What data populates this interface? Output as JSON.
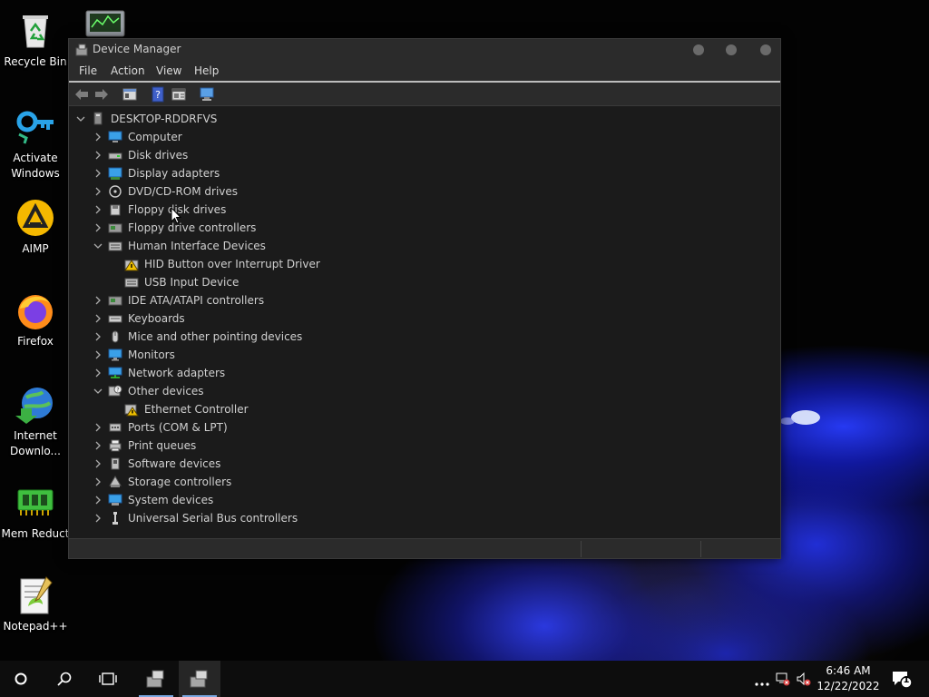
{
  "desktop": {
    "icons": [
      {
        "label": "Recycle Bin"
      },
      {
        "label": "Activate Windows"
      },
      {
        "label": "AIMP"
      },
      {
        "label": "Firefox"
      },
      {
        "label": "Internet Downlo..."
      },
      {
        "label": "Mem Reduct"
      },
      {
        "label": "Notepad++"
      }
    ]
  },
  "window": {
    "title": "Device Manager",
    "menu": [
      "File",
      "Action",
      "View",
      "Help"
    ],
    "tree": {
      "root": "DESKTOP-RDDRFVS",
      "items": [
        {
          "label": "Computer",
          "icon": "computer-icon",
          "expanded": false
        },
        {
          "label": "Disk drives",
          "icon": "disk-drive-icon",
          "expanded": false
        },
        {
          "label": "Display adapters",
          "icon": "display-adapter-icon",
          "expanded": false
        },
        {
          "label": "DVD/CD-ROM drives",
          "icon": "dvd-drive-icon",
          "expanded": false
        },
        {
          "label": "Floppy disk drives",
          "icon": "floppy-disk-icon",
          "expanded": false
        },
        {
          "label": "Floppy drive controllers",
          "icon": "floppy-controller-icon",
          "expanded": false
        },
        {
          "label": "Human Interface Devices",
          "icon": "hid-icon",
          "expanded": true
        },
        {
          "label": "HID Button over Interrupt Driver",
          "icon": "hid-warning-icon",
          "child": true
        },
        {
          "label": "USB Input Device",
          "icon": "hid-device-icon",
          "child": true
        },
        {
          "label": "IDE ATA/ATAPI controllers",
          "icon": "ide-controller-icon",
          "expanded": false
        },
        {
          "label": "Keyboards",
          "icon": "keyboard-icon",
          "expanded": false
        },
        {
          "label": "Mice and other pointing devices",
          "icon": "mouse-icon",
          "expanded": false
        },
        {
          "label": "Monitors",
          "icon": "monitor-icon",
          "expanded": false
        },
        {
          "label": "Network adapters",
          "icon": "network-adapter-icon",
          "expanded": false
        },
        {
          "label": "Other devices",
          "icon": "other-devices-icon",
          "expanded": true
        },
        {
          "label": "Ethernet Controller",
          "icon": "unknown-device-warning-icon",
          "child": true
        },
        {
          "label": "Ports (COM & LPT)",
          "icon": "ports-icon",
          "expanded": false
        },
        {
          "label": "Print queues",
          "icon": "printer-icon",
          "expanded": false
        },
        {
          "label": "Software devices",
          "icon": "software-device-icon",
          "expanded": false
        },
        {
          "label": "Storage controllers",
          "icon": "storage-controller-icon",
          "expanded": false
        },
        {
          "label": "System devices",
          "icon": "system-device-icon",
          "expanded": false
        },
        {
          "label": "Universal Serial Bus controllers",
          "icon": "usb-icon",
          "expanded": false
        }
      ]
    }
  },
  "taskbar": {
    "time": "6:46 AM",
    "date": "12/22/2022",
    "notification_count": "1"
  },
  "colors": {
    "window_bg": "#1b1b1b",
    "chrome_bg": "#2b2b2b",
    "text": "#d0d0d0",
    "wallpaper_accent": "#2b3cf0",
    "taskbar_active_underline": "#7aa7e0"
  }
}
